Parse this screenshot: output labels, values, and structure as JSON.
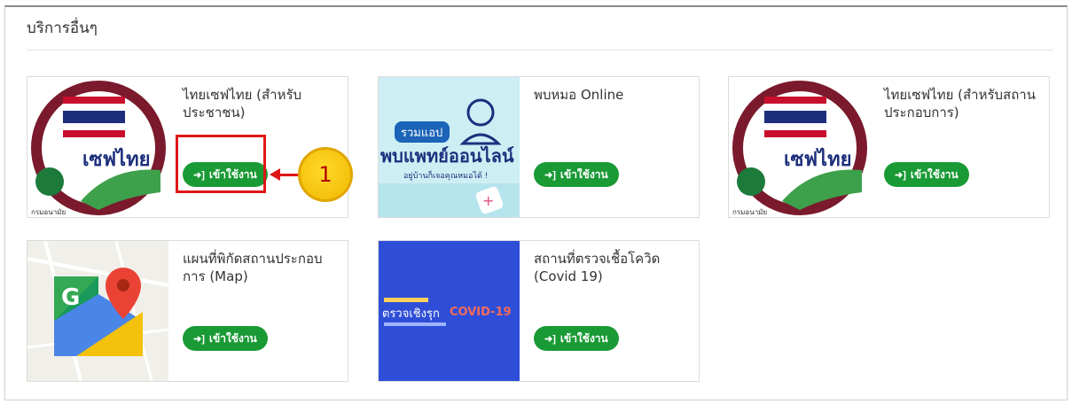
{
  "panel": {
    "title": "บริการอื่นๆ"
  },
  "cards": [
    {
      "title": "ไทยเซฟไทย (สำหรับประชาชน)",
      "button": "เข้าใช้งาน",
      "thumb_text": "เซฟไทย",
      "thumb_sub": "กรมอนามัย"
    },
    {
      "title": "พบหมอ Online",
      "button": "เข้าใช้งาน",
      "thumb_text_1": "รวมแอป",
      "thumb_text_2": "พบแพทย์ออนไลน์",
      "thumb_text_3": "อยู่บ้านก็เจอคุณหมอได้ !"
    },
    {
      "title": "ไทยเซฟไทย (สำหรับสถานประกอบการ)",
      "button": "เข้าใช้งาน",
      "thumb_text": "เซฟไทย",
      "thumb_sub": "กรมอนามัย"
    },
    {
      "title": "แผนที่พิกัดสถานประกอบการ (Map)",
      "button": "เข้าใช้งาน",
      "thumb_letter": "G"
    },
    {
      "title": "สถานที่ตรวจเชื้อโควิด (Covid 19)",
      "button": "เข้าใช้งาน",
      "thumb_text_1": "ตรวจเชิงรุก",
      "thumb_text_2": "COVID-19"
    }
  ],
  "callout": {
    "number": "1"
  },
  "icons": {
    "login": "login-icon"
  },
  "colors": {
    "button": "#1a9a35",
    "callout": "#e01616",
    "callout_circle": "#f1b800"
  }
}
